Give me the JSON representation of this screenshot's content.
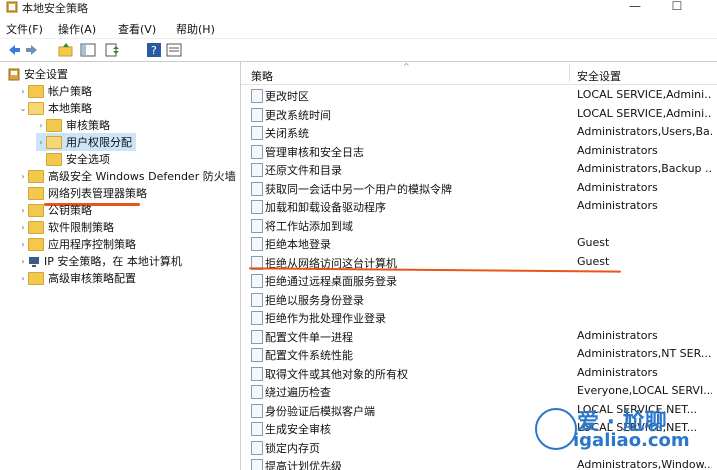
{
  "window": {
    "title": "本地安全策略"
  },
  "menubar": {
    "items": [
      "文件(F)",
      "操作(A)",
      "查看(V)",
      "帮助(H)"
    ]
  },
  "tree": {
    "root": "安全设置",
    "account_policies": "帐户策略",
    "local_policies": "本地策略",
    "audit_policy": "审核策略",
    "user_rights": "用户权限分配",
    "security_options": "安全选项",
    "defender_firewall": "高级安全 Windows Defender 防火墙",
    "network_list": "网络列表管理器策略",
    "public_key": "公钥策略",
    "software_restriction": "软件限制策略",
    "app_control": "应用程序控制策略",
    "ipsec": "IP 安全策略，在 本地计算机",
    "advanced_audit": "高级审核策略配置"
  },
  "columns": {
    "policy": "策略",
    "setting": "安全设置"
  },
  "policies": [
    {
      "name": "更改时区",
      "value": "LOCAL SERVICE,Admini..."
    },
    {
      "name": "更改系统时间",
      "value": "LOCAL SERVICE,Admini..."
    },
    {
      "name": "关闭系统",
      "value": "Administrators,Users,Ba..."
    },
    {
      "name": "管理审核和安全日志",
      "value": "Administrators"
    },
    {
      "name": "还原文件和目录",
      "value": "Administrators,Backup ..."
    },
    {
      "name": "获取同一会话中另一个用户的模拟令牌",
      "value": "Administrators"
    },
    {
      "name": "加载和卸载设备驱动程序",
      "value": "Administrators"
    },
    {
      "name": "将工作站添加到域",
      "value": ""
    },
    {
      "name": "拒绝本地登录",
      "value": "Guest"
    },
    {
      "name": "拒绝从网络访问这台计算机",
      "value": "Guest"
    },
    {
      "name": "拒绝通过远程桌面服务登录",
      "value": ""
    },
    {
      "name": "拒绝以服务身份登录",
      "value": ""
    },
    {
      "name": "拒绝作为批处理作业登录",
      "value": ""
    },
    {
      "name": "配置文件单一进程",
      "value": "Administrators"
    },
    {
      "name": "配置文件系统性能",
      "value": "Administrators,NT SER..."
    },
    {
      "name": "取得文件或其他对象的所有权",
      "value": "Administrators"
    },
    {
      "name": "绕过遍历检查",
      "value": "Everyone,LOCAL SERVI..."
    },
    {
      "name": "身份验证后模拟客户端",
      "value": "LOCAL SERVICE,NET..."
    },
    {
      "name": "生成安全审核",
      "value": "LOCAL SERVICE,NET..."
    },
    {
      "name": "锁定内存页",
      "value": ""
    },
    {
      "name": "提高计划优先级",
      "value": "Administrators,Window..."
    }
  ],
  "watermark": {
    "top": "爱 · 尬聊",
    "bottom": "igaliao.com"
  },
  "colors": {
    "highlight": "#e8541b",
    "selection": "#cce4f7",
    "watermark": "#2b77c9"
  }
}
